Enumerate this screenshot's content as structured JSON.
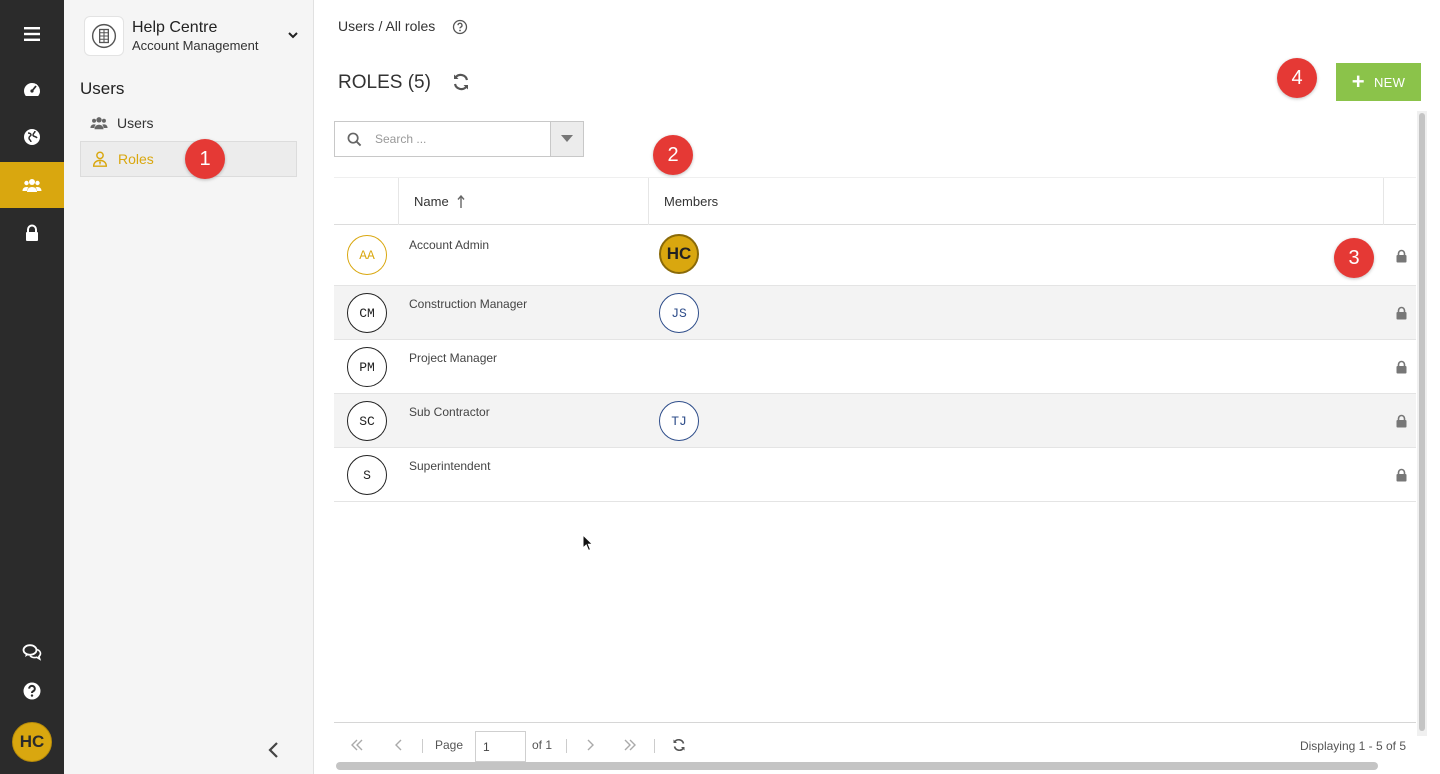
{
  "rail": {
    "items": [
      {
        "name": "menu-icon"
      },
      {
        "name": "dashboard-icon"
      },
      {
        "name": "globe-icon"
      },
      {
        "name": "users-group-icon",
        "active": true
      },
      {
        "name": "lock-icon"
      },
      {
        "name": "chat-icon"
      },
      {
        "name": "help-icon"
      }
    ],
    "user_initials": "HC",
    "accent_color": "#d9a70f"
  },
  "sidebar": {
    "org_name": "Help Centre",
    "org_subtitle": "Account Management",
    "heading": "Users",
    "items": [
      {
        "label": "Users",
        "icon": "users-group-icon",
        "active": false
      },
      {
        "label": "Roles",
        "icon": "user-tie-icon",
        "active": true
      }
    ]
  },
  "main": {
    "breadcrumb": "Users / All roles",
    "title": "ROLES (5)",
    "new_button": "NEW",
    "new_button_color": "#8bc34a",
    "search": {
      "placeholder": "Search ...",
      "value": ""
    },
    "columns": {
      "name": "Name",
      "members": "Members"
    },
    "roles": [
      {
        "initials": "AA",
        "name": "Account Admin",
        "member": "HC",
        "locked": true
      },
      {
        "initials": "CM",
        "name": "Construction Manager",
        "member": "JS",
        "locked": true
      },
      {
        "initials": "PM",
        "name": "Project Manager",
        "member": "",
        "locked": true
      },
      {
        "initials": "SC",
        "name": "Sub Contractor",
        "member": "TJ",
        "locked": true
      },
      {
        "initials": "S",
        "name": "Superintendent",
        "member": "",
        "locked": true
      }
    ],
    "pager": {
      "page_label": "Page",
      "page_value": "1",
      "of_label": "of 1",
      "status": "Displaying 1 - 5 of 5"
    }
  },
  "badges": [
    "1",
    "2",
    "3",
    "4"
  ],
  "badge_color": "#e53935"
}
